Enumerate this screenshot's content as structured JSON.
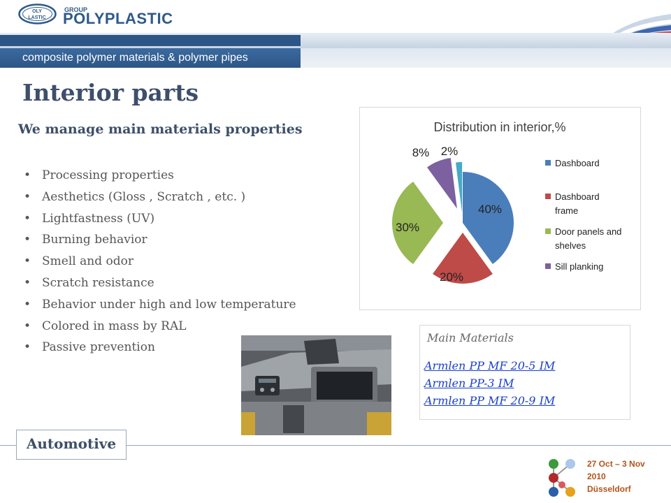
{
  "header": {
    "logo_oval_text": [
      "OLY",
      "LASTIC"
    ],
    "logo_group": "GROUP",
    "logo_name": "POLYPLASTIC",
    "tagline": "composite polymer materials & polymer pipes"
  },
  "main": {
    "title": "Interior parts",
    "subtitle": "We manage main  materials properties",
    "bullets": [
      "Processing properties",
      "Aesthetics (Gloss , Scratch , etc. )",
      "Lightfastness  (UV)",
      "Burning behavior",
      "Smell and odor",
      "Scratch resistance",
      "Behavior under high and low temperature",
      "Colored in mass by RAL",
      "Passive  prevention"
    ]
  },
  "materials": {
    "heading": "Main Materials",
    "links": [
      "Armlen PP MF 20-5 IM",
      "Armlen PP-3 IM",
      "Armlen PP MF 20-9 IM"
    ]
  },
  "footer": {
    "category": "Automotive",
    "event_lines": [
      "27 Oct – 3 Nov",
      "2010",
      "Düsseldorf"
    ]
  },
  "chart_data": {
    "type": "pie",
    "title": "Distribution in interior,%",
    "slices": [
      {
        "label": "Dashboard",
        "value": 40,
        "display": "40%",
        "color": "#4a7ebb"
      },
      {
        "label": "Dashboard frame",
        "value": 20,
        "display": "20%",
        "color": "#be4b48"
      },
      {
        "label": "Door panels and shelves",
        "value": 30,
        "display": "30%",
        "color": "#98b954"
      },
      {
        "label": "Sill planking",
        "value": 8,
        "display": "8%",
        "color": "#7d60a0"
      },
      {
        "label": "",
        "value": 2,
        "display": "2%",
        "color": "#46aac5"
      }
    ],
    "legend": {
      "position": "right",
      "entries": [
        {
          "lines": [
            "Dashboard"
          ],
          "color": "#4a7ebb"
        },
        {
          "lines": [
            "Dashboard",
            "frame"
          ],
          "color": "#be4b48"
        },
        {
          "lines": [
            "Door panels and",
            "shelves"
          ],
          "color": "#98b954"
        },
        {
          "lines": [
            "Sill planking"
          ],
          "color": "#7d60a0"
        }
      ]
    },
    "exploded": true
  }
}
